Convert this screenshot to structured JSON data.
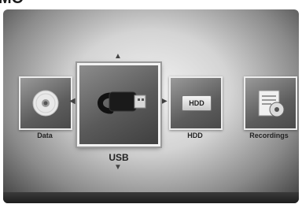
{
  "header": {
    "title_fragment": "MO"
  },
  "menu": {
    "items": [
      {
        "label": "Data",
        "icon": "disc-icon"
      },
      {
        "label": "USB",
        "icon": "usb-icon",
        "selected": true
      },
      {
        "label": "HDD",
        "icon": "hdd-icon",
        "badge": "HDD"
      },
      {
        "label": "Recordings",
        "icon": "recordings-icon"
      }
    ]
  }
}
